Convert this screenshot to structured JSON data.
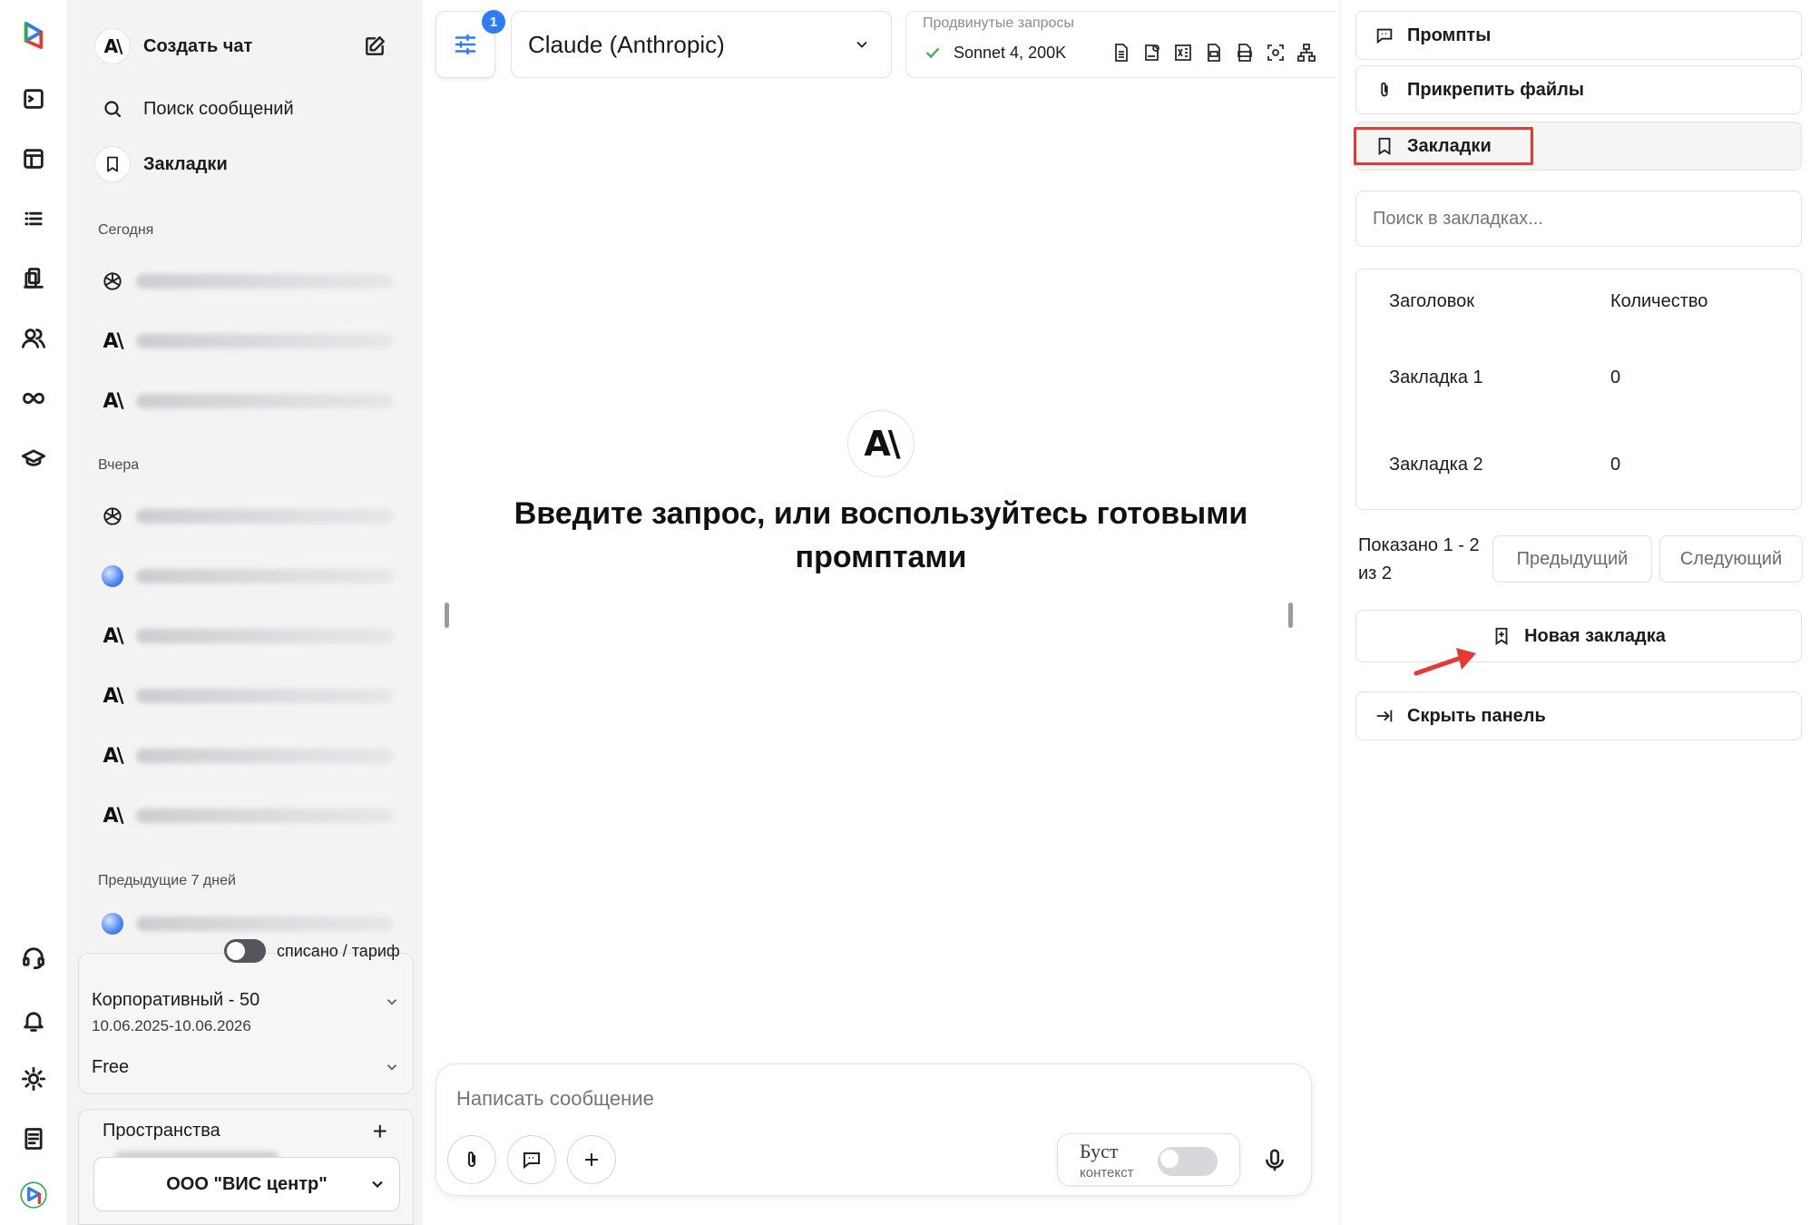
{
  "colors": {
    "accent": "#2f7cf6",
    "highlight": "#e53935",
    "badge": "#2f7cf6"
  },
  "rail": {
    "items": [
      "logo-icon",
      "terminal-icon",
      "layout-icon",
      "list-icon",
      "documents-icon",
      "users-icon",
      "infinity-icon",
      "graduation-cap-icon"
    ],
    "bottom": [
      "headset-icon",
      "bell-icon",
      "sun-icon",
      "notes-icon",
      "app-logo-icon"
    ]
  },
  "sidebar": {
    "new_chat": "Создать чат",
    "search": "Поиск сообщений",
    "bookmarks": "Закладки",
    "sections": {
      "today": "Сегодня",
      "yesterday": "Вчера",
      "prev7": "Предыдущие 7 дней"
    },
    "tariff": {
      "toggle_label": "списано / тариф",
      "plan": "Корпоративный - 50",
      "period": "10.06.2025-10.06.2026",
      "free": "Free"
    },
    "spaces": {
      "title": "Пространства",
      "selected": "ООО \"ВИС центр\""
    }
  },
  "main": {
    "settings_badge": "1",
    "model": "Claude (Anthropic)",
    "advanced_title": "Продвинутые запросы",
    "advanced_value": "Sonnet 4, 200K",
    "logo": "A\\",
    "prompt_line1": "Введите запрос, или воспользуйтесь готовыми",
    "prompt_line2": "промптами",
    "composer": {
      "placeholder": "Написать сообщение",
      "boost": "Буст",
      "boost_sub": "контекст"
    }
  },
  "panel": {
    "prompts": "Промпты",
    "attach": "Прикрепить файлы",
    "bookmarks": "Закладки",
    "search_placeholder": "Поиск в закладках...",
    "table": {
      "headers": [
        "Заголовок",
        "Количество"
      ],
      "rows": [
        {
          "title": "Закладка 1",
          "count": "0"
        },
        {
          "title": "Закладка 2",
          "count": "0"
        }
      ]
    },
    "pagination": {
      "shown_line1": "Показано 1 - 2",
      "shown_line2": "из 2",
      "prev": "Предыдущий",
      "next": "Следующий"
    },
    "new_bookmark": "Новая закладка",
    "hide_panel": "Скрыть панель"
  }
}
